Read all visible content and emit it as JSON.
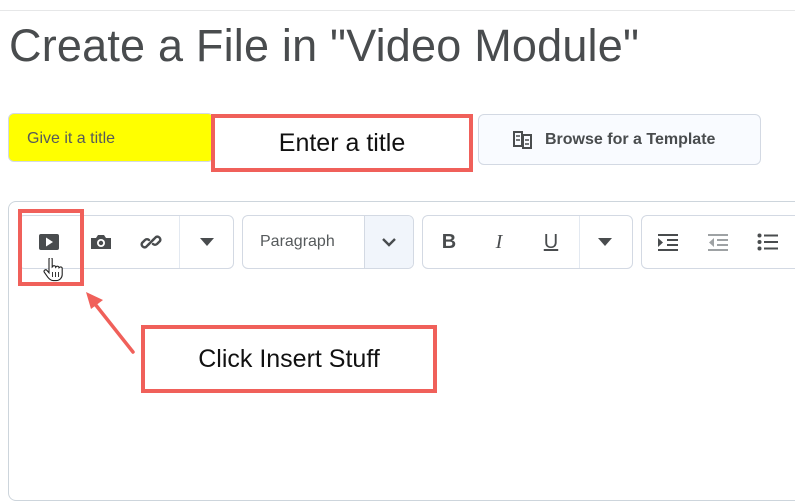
{
  "page": {
    "title": "Create a File in \"Video Module\""
  },
  "form": {
    "title_input": {
      "placeholder": "Give it a title"
    },
    "browse_template_label": "Browse for a Template"
  },
  "toolbar": {
    "insert_group": [
      {
        "name": "insert-stuff",
        "icon": "play-icon"
      },
      {
        "name": "insert-image",
        "icon": "camera-icon"
      },
      {
        "name": "insert-link",
        "icon": "link-icon"
      },
      {
        "name": "more-insert",
        "icon": "caret-down-icon"
      }
    ],
    "format_select": {
      "value": "Paragraph",
      "icon": "chevron-down-icon"
    },
    "text_style_group": {
      "bold": "B",
      "italic": "I",
      "underline": "U"
    },
    "list_group": [
      "indent-icon",
      "outdent-icon",
      "bullet-list-icon"
    ]
  },
  "annotations": {
    "title_callout": "Enter a title",
    "insert_callout": "Click Insert Stuff",
    "highlight_color": "#ffff00",
    "callout_border_color": "#f0605a"
  }
}
